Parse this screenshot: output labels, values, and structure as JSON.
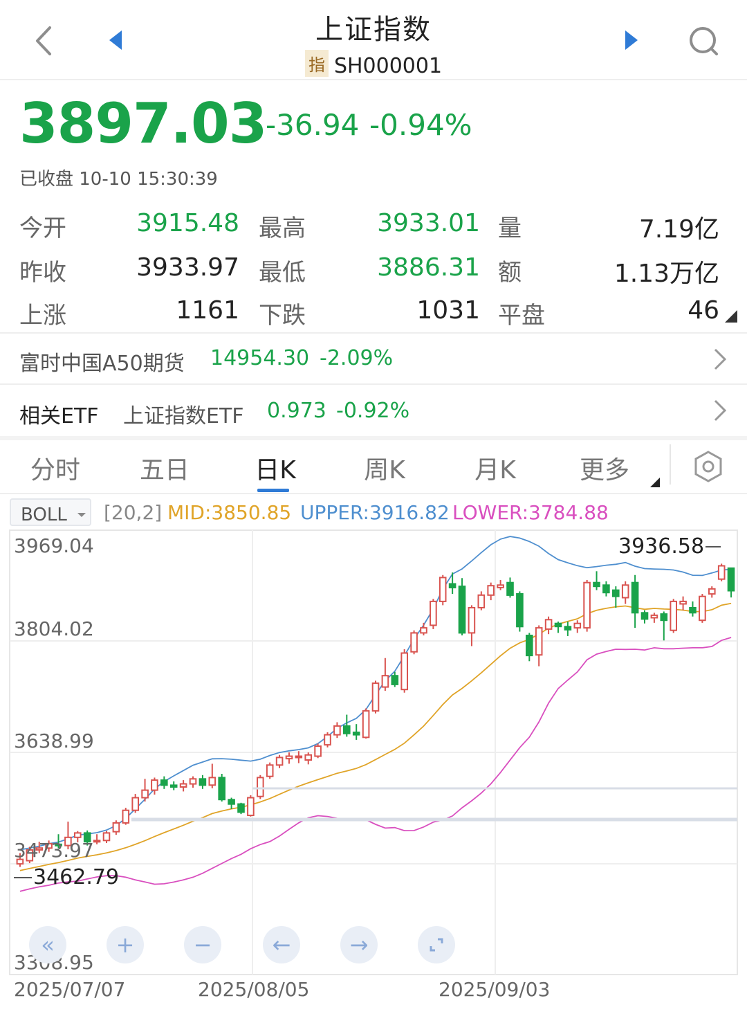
{
  "header": {
    "title": "上证指数",
    "badge": "指",
    "code": "SH000001"
  },
  "quote": {
    "price": "3897.03",
    "change": "-36.94",
    "change_pct": "-0.94%",
    "status": "已收盘 10-10 15:30:39"
  },
  "stats": [
    [
      {
        "label": "今开",
        "value": "3915.48",
        "color": "green"
      },
      {
        "label": "最高",
        "value": "3933.01",
        "color": "green"
      },
      {
        "label": "量",
        "value": "7.19亿",
        "color": "black"
      }
    ],
    [
      {
        "label": "昨收",
        "value": "3933.97",
        "color": "black"
      },
      {
        "label": "最低",
        "value": "3886.31",
        "color": "green"
      },
      {
        "label": "额",
        "value": "1.13万亿",
        "color": "black"
      }
    ],
    [
      {
        "label": "上涨",
        "value": "1161",
        "color": "black"
      },
      {
        "label": "下跌",
        "value": "1031",
        "color": "black"
      },
      {
        "label": "平盘",
        "value": "46",
        "color": "black"
      }
    ]
  ],
  "futures": {
    "name": "富时中国A50期货",
    "value": "14954.30",
    "pct": "-2.09%"
  },
  "etf": {
    "label": "相关ETF",
    "name": "上证指数ETF",
    "value": "0.973",
    "pct": "-0.92%"
  },
  "tabs": [
    "分时",
    "五日",
    "日K",
    "周K",
    "月K",
    "更多"
  ],
  "active_tab": "日K",
  "indicator": {
    "name": "BOLL",
    "params": "[20,2]",
    "mid": "MID:3850.85",
    "upper": "UPPER:3916.82",
    "lower": "LOWER:3784.88",
    "colors": {
      "mid": "#e0a428",
      "upper": "#4f8fcf",
      "lower": "#d94fbf",
      "up": "#d9534f",
      "down": "#1aa34a"
    }
  },
  "chart": {
    "y_labels": [
      "3969.04",
      "3804.02",
      "3638.99",
      "3473.97",
      "3308.95"
    ],
    "x_labels": [
      "2025/07/07",
      "2025/08/05",
      "2025/09/03"
    ],
    "max_label": "3936.58",
    "min_label": "3462.79"
  },
  "chart_data": {
    "type": "candlestick",
    "ylim": [
      3308.95,
      3969.04
    ],
    "candles": [
      [
        3462.8,
        3470.0,
        3458.0,
        3480.0
      ],
      [
        3468.0,
        3485.0,
        3464.0,
        3490.0
      ],
      [
        3485.0,
        3488.0,
        3480.0,
        3498.0
      ],
      [
        3488.0,
        3495.0,
        3482.0,
        3500.0
      ],
      [
        3494.0,
        3492.0,
        3488.0,
        3510.0
      ],
      [
        3492.0,
        3505.0,
        3486.0,
        3530.0
      ],
      [
        3505.0,
        3512.0,
        3497.0,
        3515.0
      ],
      [
        3512.0,
        3498.0,
        3492.0,
        3516.0
      ],
      [
        3498.0,
        3500.0,
        3494.0,
        3510.0
      ],
      [
        3500.0,
        3512.0,
        3496.0,
        3515.0
      ],
      [
        3514.0,
        3528.0,
        3509.0,
        3532.0
      ],
      [
        3528.0,
        3548.0,
        3525.0,
        3552.0
      ],
      [
        3548.0,
        3568.0,
        3544.0,
        3574.0
      ],
      [
        3568.0,
        3580.0,
        3562.0,
        3598.0
      ],
      [
        3580.0,
        3596.0,
        3573.0,
        3600.0
      ],
      [
        3596.0,
        3588.0,
        3582.0,
        3602.0
      ],
      [
        3588.0,
        3585.0,
        3580.0,
        3594.0
      ],
      [
        3585.0,
        3590.0,
        3578.0,
        3596.0
      ],
      [
        3590.0,
        3598.0,
        3584.0,
        3602.0
      ],
      [
        3598.0,
        3588.0,
        3582.0,
        3604.0
      ],
      [
        3588.0,
        3600.0,
        3583.0,
        3622.0
      ],
      [
        3600.0,
        3565.0,
        3562.0,
        3606.0
      ],
      [
        3565.0,
        3558.0,
        3550.0,
        3568.0
      ],
      [
        3558.0,
        3545.0,
        3542.0,
        3560.0
      ],
      [
        3540.0,
        3568.0,
        3538.0,
        3572.0
      ],
      [
        3570.0,
        3600.0,
        3566.0,
        3604.0
      ],
      [
        3602.0,
        3620.0,
        3598.0,
        3624.0
      ],
      [
        3620.0,
        3632.0,
        3615.0,
        3636.0
      ],
      [
        3630.0,
        3634.0,
        3622.0,
        3640.0
      ],
      [
        3632.0,
        3634.0,
        3623.0,
        3642.0
      ],
      [
        3628.0,
        3636.0,
        3621.0,
        3640.0
      ],
      [
        3634.0,
        3650.0,
        3631.0,
        3654.0
      ],
      [
        3652.0,
        3668.0,
        3648.0,
        3672.0
      ],
      [
        3668.0,
        3682.0,
        3663.0,
        3688.0
      ],
      [
        3682.0,
        3670.0,
        3665.0,
        3700.0
      ],
      [
        3672.0,
        3668.0,
        3660.0,
        3685.0
      ],
      [
        3664.0,
        3706.0,
        3662.0,
        3710.0
      ],
      [
        3706.0,
        3750.0,
        3702.0,
        3754.0
      ],
      [
        3744.0,
        3762.0,
        3738.0,
        3790.0
      ],
      [
        3762.0,
        3748.0,
        3744.0,
        3768.0
      ],
      [
        3740.0,
        3798.0,
        3735.0,
        3804.0
      ],
      [
        3800.0,
        3830.0,
        3796.0,
        3834.0
      ],
      [
        3830.0,
        3838.0,
        3826.0,
        3846.0
      ],
      [
        3842.0,
        3880.0,
        3836.0,
        3884.0
      ],
      [
        3880.0,
        3918.0,
        3874.0,
        3922.0
      ],
      [
        3908.0,
        3902.0,
        3892.0,
        3926.0
      ],
      [
        3904.0,
        3830.0,
        3826.0,
        3917.0
      ],
      [
        3830.0,
        3870.0,
        3809.0,
        3874.0
      ],
      [
        3870.0,
        3890.0,
        3866.0,
        3896.0
      ],
      [
        3890.0,
        3905.0,
        3882.0,
        3910.0
      ],
      [
        3902.0,
        3906.0,
        3898.0,
        3914.0
      ],
      [
        3910.0,
        3890.0,
        3886.0,
        3918.0
      ],
      [
        3892.0,
        3840.0,
        3832.0,
        3896.0
      ],
      [
        3826.0,
        3794.0,
        3785.0,
        3830.0
      ],
      [
        3795.0,
        3838.0,
        3777.0,
        3842.0
      ],
      [
        3836.0,
        3851.0,
        3828.0,
        3856.0
      ],
      [
        3845.0,
        3840.0,
        3830.0,
        3848.0
      ],
      [
        3840.0,
        3835.0,
        3825.0,
        3848.0
      ],
      [
        3838.0,
        3845.0,
        3830.0,
        3850.0
      ],
      [
        3838.0,
        3910.0,
        3832.0,
        3914.0
      ],
      [
        3910.0,
        3904.0,
        3898.0,
        3928.0
      ],
      [
        3906.0,
        3894.0,
        3888.0,
        3912.0
      ],
      [
        3898.0,
        3888.0,
        3870.0,
        3904.0
      ],
      [
        3886.0,
        3906.0,
        3876.0,
        3912.0
      ],
      [
        3910.0,
        3862.0,
        3838.0,
        3922.0
      ],
      [
        3862.0,
        3852.0,
        3845.0,
        3866.0
      ],
      [
        3854.0,
        3858.0,
        3846.0,
        3862.0
      ],
      [
        3860.0,
        3850.0,
        3818.0,
        3864.0
      ],
      [
        3834.0,
        3880.0,
        3830.0,
        3884.0
      ],
      [
        3876.0,
        3880.0,
        3866.0,
        3888.0
      ],
      [
        3870.0,
        3862.0,
        3856.0,
        3880.0
      ],
      [
        3850.0,
        3888.0,
        3846.0,
        3892.0
      ],
      [
        3892.0,
        3900.0,
        3886.0,
        3904.0
      ],
      [
        3915.5,
        3936.6,
        3912.0,
        3940.0
      ],
      [
        3933.0,
        3897.0,
        3886.3,
        3933.0
      ]
    ]
  }
}
